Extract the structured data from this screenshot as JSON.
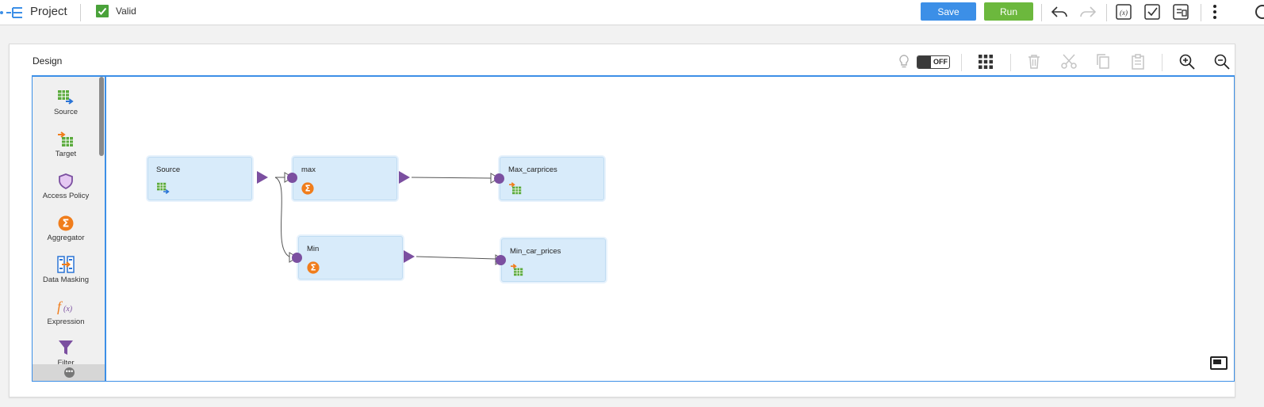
{
  "header": {
    "project_label": "Project",
    "status_label": "Valid",
    "save_label": "Save",
    "run_label": "Run"
  },
  "design": {
    "title": "Design",
    "auto_link_toggle": "OFF"
  },
  "palette": {
    "items": [
      {
        "label": "Source",
        "icon": "source-icon"
      },
      {
        "label": "Target",
        "icon": "target-icon"
      },
      {
        "label": "Access Policy",
        "icon": "access-policy-icon"
      },
      {
        "label": "Aggregator",
        "icon": "aggregator-icon"
      },
      {
        "label": "Data Masking",
        "icon": "data-masking-icon"
      },
      {
        "label": "Expression",
        "icon": "expression-icon"
      },
      {
        "label": "Filter",
        "icon": "filter-icon"
      }
    ]
  },
  "flow": {
    "nodes": [
      {
        "name": "Source",
        "type": "source"
      },
      {
        "name": "max",
        "type": "aggregator"
      },
      {
        "name": "Max_carprices",
        "type": "target"
      },
      {
        "name": "Min",
        "type": "aggregator"
      },
      {
        "name": "Min_car_prices",
        "type": "target"
      }
    ],
    "links": [
      {
        "from": "Source",
        "to": "max"
      },
      {
        "from": "Source",
        "to": "Min"
      },
      {
        "from": "max",
        "to": "Max_carprices"
      },
      {
        "from": "Min",
        "to": "Min_car_prices"
      }
    ]
  },
  "colors": {
    "save": "#3c8fe7",
    "run": "#6cb83d",
    "valid": "#4aa23a",
    "node_fill": "#d8ebfa",
    "port": "#7b4fa0",
    "aggregator": "#f07d1c"
  }
}
